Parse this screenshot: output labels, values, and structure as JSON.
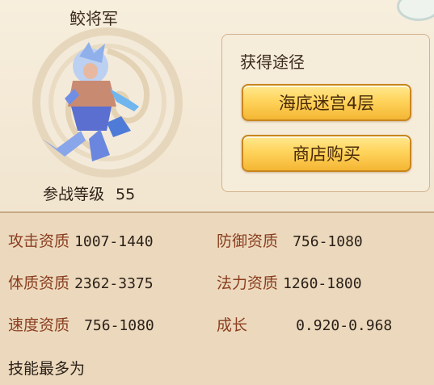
{
  "pet": {
    "name": "鲛将军",
    "level_label": "参战等级",
    "level_value": "55"
  },
  "sources": {
    "title": "获得途径",
    "buttons": [
      "海底迷宫4层",
      "商店购买"
    ]
  },
  "stats": {
    "attack": {
      "label": "攻击资质",
      "value": "1007-1440"
    },
    "defense": {
      "label": "防御资质",
      "value": "756-1080"
    },
    "stamina": {
      "label": "体质资质",
      "value": "2362-3375"
    },
    "magic": {
      "label": "法力资质",
      "value": "1260-1800"
    },
    "speed": {
      "label": "速度资质",
      "value": "756-1080"
    },
    "growth": {
      "label": "成长",
      "value": "0.920-0.968"
    },
    "skills_label": "技能最多为"
  },
  "colors": {
    "label": "#8a3e20",
    "button": "#ffd45c",
    "panel": "#f6ecda"
  }
}
